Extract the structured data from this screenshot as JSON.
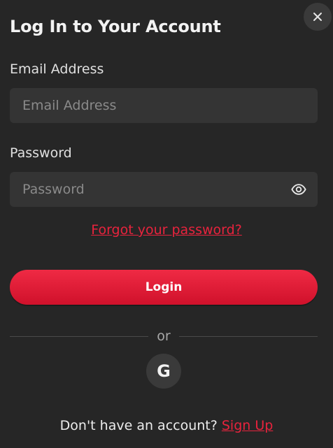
{
  "header": {
    "title": "Log In to Your Account",
    "close_icon": "close-icon"
  },
  "email": {
    "label": "Email Address",
    "placeholder": "Email Address",
    "value": ""
  },
  "password": {
    "label": "Password",
    "placeholder": "Password",
    "value": "",
    "toggle_icon": "eye-icon"
  },
  "forgot_password": "Forgot your password?",
  "login_button": "Login",
  "divider_text": "or",
  "social": {
    "google_glyph": "G",
    "google_icon": "google-icon"
  },
  "footer": {
    "prompt": "Don't have an account?",
    "signup_link": "Sign Up"
  },
  "colors": {
    "background": "#262626",
    "input_background": "#343434",
    "accent": "#e8233d",
    "text": "#e6e6e6",
    "placeholder": "#8a8a8a"
  }
}
